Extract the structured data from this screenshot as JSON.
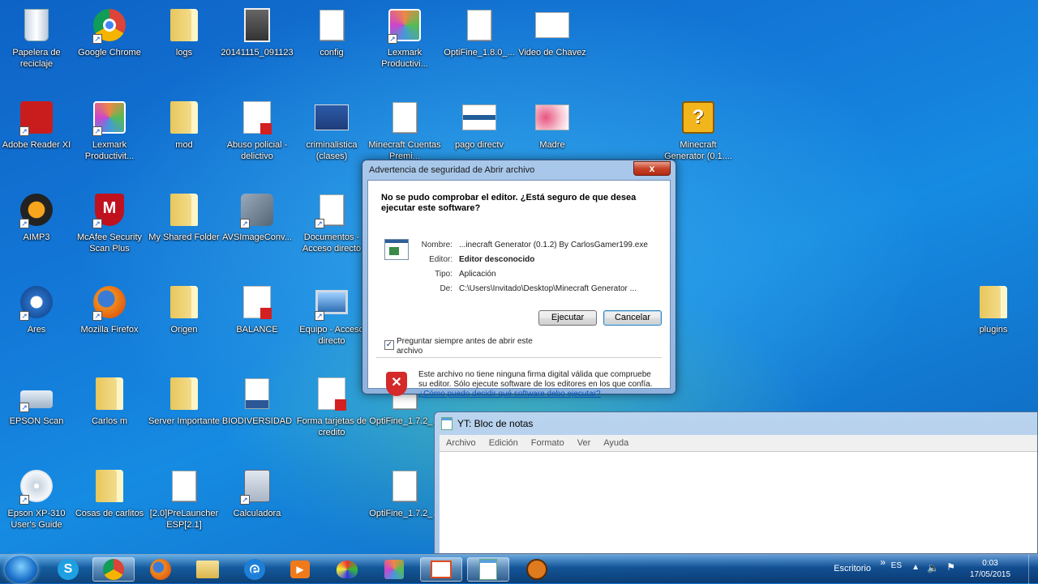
{
  "desktop": {
    "icons": [
      {
        "label": "Papelera de reciclaje"
      },
      {
        "label": "Google Chrome"
      },
      {
        "label": "logs"
      },
      {
        "label": "20141115_091123"
      },
      {
        "label": "config"
      },
      {
        "label": "Lexmark Productivi..."
      },
      {
        "label": "OptiFine_1.8.0_..."
      },
      {
        "label": "Video de Chavez"
      },
      {
        "label": "Adobe Reader XI"
      },
      {
        "label": "Lexmark Productivit..."
      },
      {
        "label": "mod"
      },
      {
        "label": "Abuso policial - delictivo"
      },
      {
        "label": "criminalistica (clases)"
      },
      {
        "label": "Minecraft Cuentas Premi..."
      },
      {
        "label": "pago directv"
      },
      {
        "label": "Madre"
      },
      {
        "label": "Minecraft Generator (0.1...."
      },
      {
        "label": "AIMP3"
      },
      {
        "label": "McAfee Security Scan Plus"
      },
      {
        "label": "My Shared Folder"
      },
      {
        "label": "AVSImageConv..."
      },
      {
        "label": "Documentos - Acceso directo"
      },
      {
        "label": "Ares"
      },
      {
        "label": "Mozilla Firefox"
      },
      {
        "label": "Origen"
      },
      {
        "label": "BALANCE"
      },
      {
        "label": "Equipo - Acceso directo"
      },
      {
        "label": "plugins"
      },
      {
        "label": "EPSON Scan"
      },
      {
        "label": "Carlos m"
      },
      {
        "label": "Server Importante"
      },
      {
        "label": "BIODIVERSIDAD"
      },
      {
        "label": "Forma tarjetas de credito"
      },
      {
        "label": "OptiFine_1.7.2_..."
      },
      {
        "label": "Epson XP-310 User's Guide"
      },
      {
        "label": "Cosas de carlitos"
      },
      {
        "label": "[2.0]PreLauncher ESP[2.1]"
      },
      {
        "label": "Calculadora"
      },
      {
        "label": "OptiFine_1.7.2_..."
      }
    ]
  },
  "dialog": {
    "title": "Advertencia de seguridad de Abrir archivo",
    "close_label": "x",
    "question": "No se pudo comprobar el editor. ¿Está seguro de que desea ejecutar este software?",
    "fields": [
      {
        "key": "Nombre:",
        "value": "...inecraft Generator (0.1.2) By CarlosGamer199.exe",
        "bold": false
      },
      {
        "key": "Editor:",
        "value": "Editor desconocido",
        "bold": true
      },
      {
        "key": "Tipo:",
        "value": "Aplicación",
        "bold": false
      },
      {
        "key": "De:",
        "value": "C:\\Users\\Invitado\\Desktop\\Minecraft Generator ...",
        "bold": false
      }
    ],
    "run_label": "Ejecutar",
    "cancel_label": "Cancelar",
    "checkbox_label": "Preguntar siempre antes de abrir este archivo",
    "checkbox_checked": true,
    "warning_text": "Este archivo no tiene ninguna firma digital válida que compruebe su editor. Sólo ejecute software de los editores en los que confía.",
    "warning_link": "¿Cómo puedo decidir qué software debo ejecutar?"
  },
  "notepad": {
    "title": "YT: Bloc de notas",
    "menu": [
      "Archivo",
      "Edición",
      "Formato",
      "Ver",
      "Ayuda"
    ]
  },
  "taskbar": {
    "desktop_label": "Escritorio",
    "chevron": "»",
    "language": "ES",
    "time": "0:03",
    "date": "17/05/2015"
  }
}
